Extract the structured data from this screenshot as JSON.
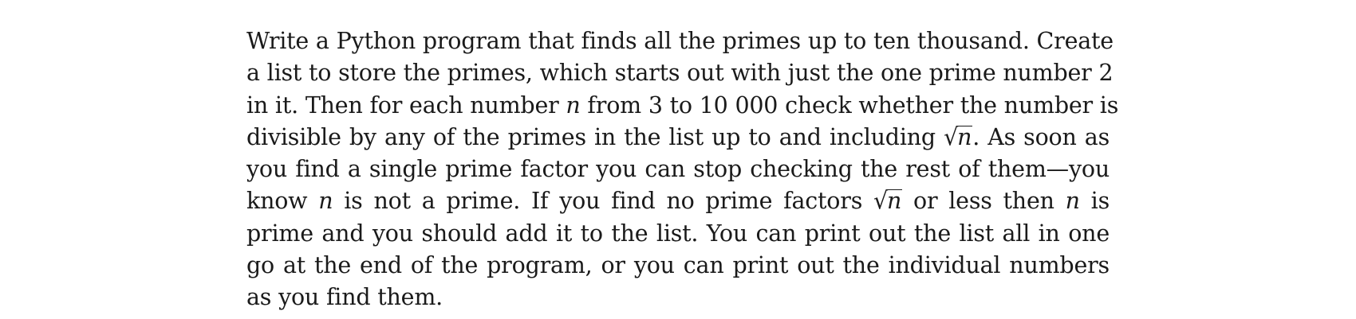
{
  "document": {
    "lines": [
      {
        "segments": [
          {
            "text": "Write a Python program that finds all the primes up to ten thousand. Create"
          }
        ]
      },
      {
        "segments": [
          {
            "text": "a list to store the primes, which starts out with just the one prime number 2"
          }
        ]
      },
      {
        "segments": [
          {
            "text": "in it. Then for each number "
          },
          {
            "math": "n"
          },
          {
            "text": " from 3 to 10 000 check whether the number is"
          }
        ]
      },
      {
        "segments": [
          {
            "text": "divisible by any of the primes in the list up to and including "
          },
          {
            "sqrt": "n"
          },
          {
            "text": ". As soon as"
          }
        ]
      },
      {
        "segments": [
          {
            "text": "you find a single prime factor you can stop checking the rest of them—you"
          }
        ]
      },
      {
        "segments": [
          {
            "text": "know "
          },
          {
            "math": "n"
          },
          {
            "text": " is not a prime. If you find no prime factors "
          },
          {
            "sqrt": "n"
          },
          {
            "text": " or less then "
          },
          {
            "math": "n"
          },
          {
            "text": " is"
          }
        ]
      },
      {
        "segments": [
          {
            "text": "prime and you should add it to the list. You can print out the list all in one"
          }
        ]
      },
      {
        "segments": [
          {
            "text": "go at the end of the program, or you can print out the individual numbers"
          }
        ]
      },
      {
        "segments": [
          {
            "text": "as you find them."
          }
        ]
      }
    ]
  }
}
